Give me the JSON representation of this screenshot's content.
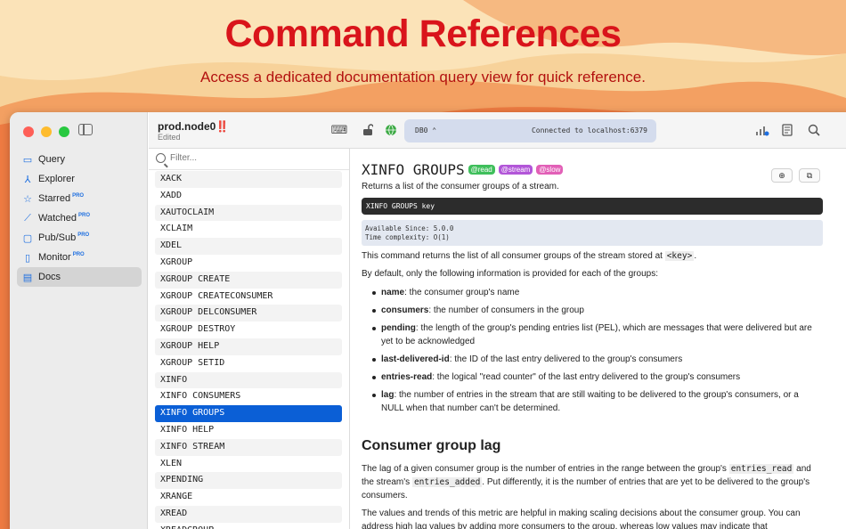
{
  "hero": {
    "title": "Command References",
    "subtitle": "Access a dedicated documentation query view for quick reference."
  },
  "colors": {
    "accent": "#0b5fd6",
    "hero_title": "#d9141b",
    "danger": "#e0151c"
  },
  "sidebar": {
    "items": [
      {
        "label": "Query",
        "icon": "terminal-icon",
        "pro": ""
      },
      {
        "label": "Explorer",
        "icon": "explorer-icon",
        "pro": ""
      },
      {
        "label": "Starred",
        "icon": "star-icon",
        "pro": "PRO"
      },
      {
        "label": "Watched",
        "icon": "chart-icon",
        "pro": "PRO"
      },
      {
        "label": "Pub/Sub",
        "icon": "pubsub-icon",
        "pro": "PRO"
      },
      {
        "label": "Monitor",
        "icon": "monitor-icon",
        "pro": "PRO"
      },
      {
        "label": "Docs",
        "icon": "docs-icon",
        "pro": ""
      }
    ]
  },
  "header": {
    "connection_name": "prod.node0",
    "connection_mark": "‼️",
    "connection_state": "Edited",
    "db_selector": "DB0 ⌃",
    "status": "Connected to localhost:6379"
  },
  "list": {
    "filter_placeholder": "Filter...",
    "commands": [
      "XACK",
      "XADD",
      "XAUTOCLAIM",
      "XCLAIM",
      "XDEL",
      "XGROUP",
      "XGROUP CREATE",
      "XGROUP CREATECONSUMER",
      "XGROUP DELCONSUMER",
      "XGROUP DESTROY",
      "XGROUP HELP",
      "XGROUP SETID",
      "XINFO",
      "XINFO CONSUMERS",
      "XINFO GROUPS",
      "XINFO HELP",
      "XINFO STREAM",
      "XLEN",
      "XPENDING",
      "XRANGE",
      "XREAD",
      "XREADGROUP"
    ],
    "selected_index": 14
  },
  "doc": {
    "title": "XINFO GROUPS",
    "tags": [
      "@read",
      "@stream",
      "@slow"
    ],
    "summary": "Returns a list of the consumer groups of a stream.",
    "syntax": "XINFO GROUPS key",
    "available_since": "Available Since:  5.0.0",
    "time_complexity": "Time complexity:  O(1)",
    "intro_a": "This command returns the list of all consumer groups of the stream stored at ",
    "intro_code": "<key>",
    "intro_b": ".",
    "default_info": "By default, only the following information is provided for each of the groups:",
    "fields": [
      {
        "name": "name",
        "desc": ": the consumer group's name"
      },
      {
        "name": "consumers",
        "desc": ": the number of consumers in the group"
      },
      {
        "name": "pending",
        "desc": ": the length of the group's pending entries list (PEL), which are messages that were delivered but are yet to be acknowledged"
      },
      {
        "name": "last-delivered-id",
        "desc": ": the ID of the last entry delivered to the group's consumers"
      },
      {
        "name": "entries-read",
        "desc": ": the logical \"read counter\" of the last entry delivered to the group's consumers"
      },
      {
        "name": "lag",
        "desc": ": the number of entries in the stream that are still waiting to be delivered to the group's consumers, or a NULL when that number can't be determined."
      }
    ],
    "section_title": "Consumer group lag",
    "lag_p1_a": "The lag of a given consumer group is the number of entries in the range between the group's ",
    "lag_p1_code1": "entries_read",
    "lag_p1_b": " and the stream's ",
    "lag_p1_code2": "entries_added",
    "lag_p1_c": ". Put differently, it is the number of entries that are yet to be delivered to the group's consumers.",
    "lag_p2": "The values and trends of this metric are helpful in making scaling decisions about the consumer group. You can address high lag values by adding more consumers to the group, whereas low values may indicate that"
  }
}
